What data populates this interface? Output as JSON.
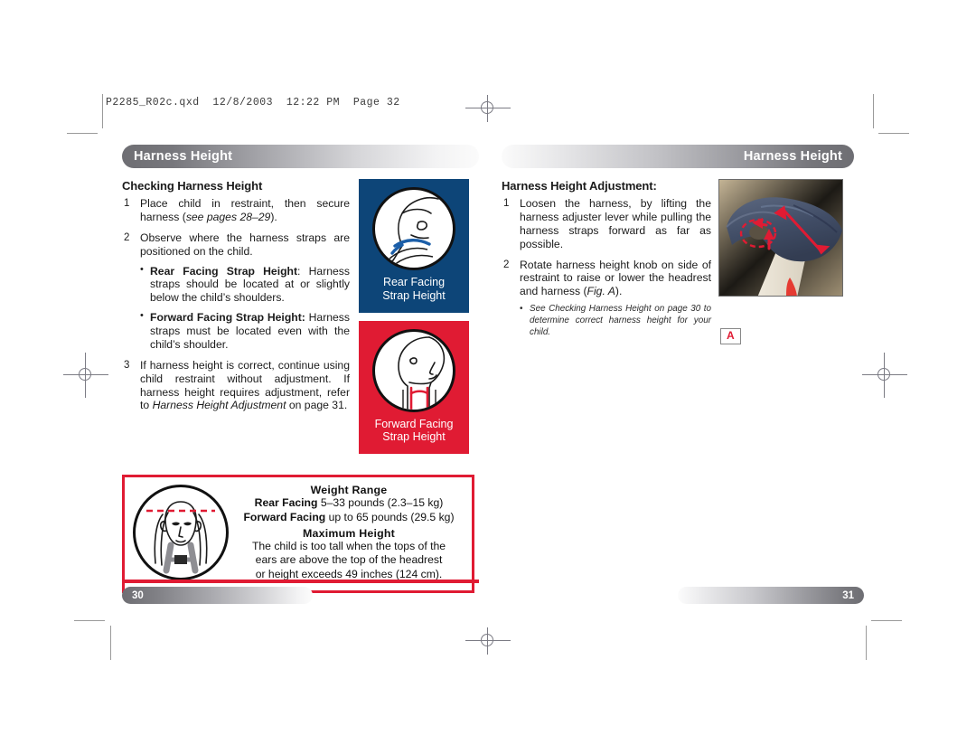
{
  "print_slug": "P2285_R02c.qxd  12/8/2003  12:22 PM  Page 32",
  "left_page": {
    "header_title": "Harness Height",
    "section_title": "Checking Harness Height",
    "steps": [
      {
        "num": "1",
        "parts": [
          {
            "text": "Place child in restraint, then secure harness (",
            "style": "normal"
          },
          {
            "text": "see pages 28–29",
            "style": "italic"
          },
          {
            "text": ").",
            "style": "normal"
          }
        ]
      },
      {
        "num": "2",
        "parts": [
          {
            "text": "Observe where the harness straps are positioned on the child.",
            "style": "normal"
          }
        ],
        "bullets": [
          {
            "parts": [
              {
                "text": "Rear Facing Strap Height",
                "style": "bold"
              },
              {
                "text": ": Harness straps should be located at or slightly below the child’s shoulders.",
                "style": "normal"
              }
            ]
          },
          {
            "parts": [
              {
                "text": "Forward Facing Strap Height:",
                "style": "bold"
              },
              {
                "text": " Harness straps must be located even with the child’s shoulder.",
                "style": "normal"
              }
            ]
          }
        ]
      },
      {
        "num": "3",
        "parts": [
          {
            "text": "If harness height is correct, continue using child restraint without adjustment. If harness height requires adjustment, refer to ",
            "style": "normal"
          },
          {
            "text": "Harness Height Adjustment",
            "style": "italic"
          },
          {
            "text": " on page 31.",
            "style": "normal"
          }
        ]
      }
    ],
    "figures": [
      {
        "id": "rear-facing",
        "caption_line1": "Rear Facing",
        "caption_line2": "Strap Height",
        "bg_color": "#0d4578",
        "strap_color": "#1b5ea8"
      },
      {
        "id": "forward-facing",
        "caption_line1": "Forward Facing",
        "caption_line2": "Strap Height",
        "bg_color": "#e01b33",
        "strap_color": "#e01b33"
      }
    ],
    "weight_box": {
      "border_color": "#e01b33",
      "heading_1": "Weight Range",
      "rear_label": "Rear Facing",
      "rear_value": "5–33 pounds (2.3–15 kg)",
      "forward_label": "Forward Facing",
      "forward_value": "up to 65 pounds (29.5 kg)",
      "heading_2": "Maximum Height",
      "body_line1": "The child is too tall when the tops of the",
      "body_line2": "ears are above the top of the headrest",
      "body_line3": "or height exceeds 49 inches (124 cm)."
    },
    "footer_page_number": "30"
  },
  "right_page": {
    "header_title": "Harness Height",
    "section_title": "Harness Height Adjustment:",
    "steps": [
      {
        "num": "1",
        "parts": [
          {
            "text": "Loosen the harness, by lifting the harness adjuster lever while pulling the harness straps forward as far as possible.",
            "style": "normal"
          }
        ]
      },
      {
        "num": "2",
        "parts": [
          {
            "text": "Rotate harness height knob on side of restraint to raise or lower the headrest and harness (",
            "style": "normal"
          },
          {
            "text": "Fig. A",
            "style": "italic"
          },
          {
            "text": ").",
            "style": "normal"
          }
        ]
      }
    ],
    "note": {
      "parts": [
        {
          "text": "See ",
          "style": "italic"
        },
        {
          "text": "Checking Harness Height",
          "style": "italic"
        },
        {
          "text": " on page 30 to determine correct harness height for your child.",
          "style": "italic"
        }
      ]
    },
    "photo": {
      "label": "A",
      "label_color": "#e01b33",
      "annotation_color": "#e01b33"
    },
    "footer_page_number": "31"
  },
  "colors": {
    "brand_red": "#e01b33",
    "brand_navy": "#0d4578",
    "header_gray": "#6e6e73",
    "text": "#1b1b1b"
  }
}
